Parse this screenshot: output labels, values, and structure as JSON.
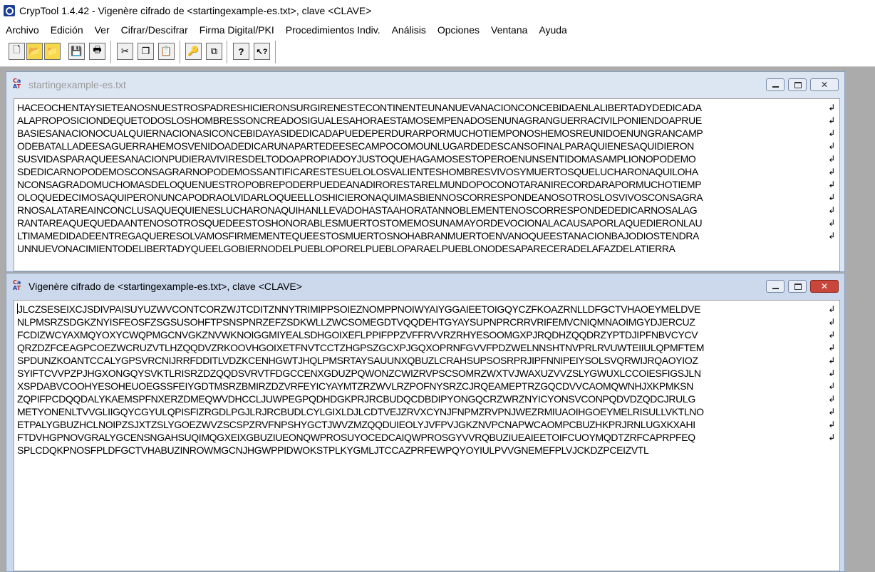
{
  "app": {
    "title": "CrypTool 1.4.42 - Vigenère cifrado de <startingexample-es.txt>, clave <CLAVE>"
  },
  "menu": [
    "Archivo",
    "Edición",
    "Ver",
    "Cifrar/Descifrar",
    "Firma Digital/PKI",
    "Procedimientos Indiv.",
    "Análisis",
    "Opciones",
    "Ventana",
    "Ayuda"
  ],
  "toolbar": {
    "buttons": [
      {
        "name": "new-document-icon",
        "glyph": "🗋"
      },
      {
        "name": "open-folder-icon",
        "glyph": "📂"
      },
      {
        "name": "open-recent-icon",
        "glyph": "📁"
      },
      {
        "name": "save-disk-icon",
        "glyph": "💾"
      },
      {
        "name": "print-icon",
        "glyph": "🖶"
      },
      {
        "name": "cut-scissors-icon",
        "glyph": "✂"
      },
      {
        "name": "copy-icon",
        "glyph": "❐"
      },
      {
        "name": "paste-icon",
        "glyph": "📋"
      },
      {
        "name": "key-icon",
        "glyph": "🔑"
      },
      {
        "name": "window-switch-icon",
        "glyph": "⧉"
      },
      {
        "name": "help-icon",
        "glyph": "?"
      },
      {
        "name": "context-help-icon",
        "glyph": "↖?"
      }
    ]
  },
  "windows": {
    "plaintext": {
      "title": "startingexample-es.txt",
      "lines": [
        "HACEOCHENTAYSIETEANOSNUESTROSPADRESHICIERONSURGIRENESTECONTINENTEUNANUEVANACIONCONCEBIDAENLALIBERTADYDEDICADA",
        "ALAPROPOSICIONDEQUETODOSLOSHOMBRESSONCREADOSIGUALESAHORAESTAMOSEMPENADOSENUNAGRANGUERRACIVILPONIENDOAPRUE",
        "BASIESANACIONOCUALQUIERNACIONASICONCEBIDAYASIDEDICADAPUEDEPERDURARPORMUCHOTIEMPONOSHEMOSREUNIDOENUNGRANCAMP",
        "ODEBATALLADEESAGUERRAHEMOSVENIDOADEDICARUNAPARTEDEESECAMPOCOMOUNLUGARDEDESCANSOFINALPARAQUIENESAQUIDIERON",
        "SUSVIDASPARAQUEESANACIONPUDIERAVIVIRESDELTODOAPROPIADOYJUSTOQUEHAGAMOSESTOPEROENUNSENTIDOMASAMPLIONOPODEMO",
        "SDEDICARNOPODEMOSCONSAGRARNOPODEMOSSANTIFICARESTESUELOLOSVALIENTESHOMBRESVIVOSYMUERTOSQUELUCHARONAQUILOHA",
        "NCONSAGRADOMUCHOMASDELOQUENUESTROPOBREPODERPUEDEANADIRORESTARELMUNDOPOCONOTARANIRECORDARAPORMUCHOTIEMP",
        "OLOQUEDECIMOSAQUIPERONUNCAPODRAOLVIDARLOQUEELLOSHICIERONAQUIMASBIENNOSCORRESPONDEANOSOTROSLOSVIVOSCONSAGRA",
        "RNOSALATAREAINCONCLUSAQUEQUIENESLUCHARONAQUIHANLLEVADOHASTAAHORATANNOBLEMENTENOSCORRESPONDEDEDICARNOSALAG",
        "RANTAREAQUEQUEDAANTENOSOTROSQUEDEESTOSHONORABLESMUERTOSTOMEMOSUNAMAYORDEVOCIONALACAUSAPORLAQUEDIERONLAU",
        "LTIMAMEDIDADEENTREGAQUERESOLVAMOSFIRMEMENTEQUEESTOSMUERTOSNOHABRANMUERTOENVANOQUEESTANACIONBAJODIOSTENDRA",
        "UNNUEVONACIMIENTODELIBERTADYQUEELGOBIERNODELPUEBLOPORELPUEBLOPARAELPUEBLONODESAPARECERADELAFAZDELATIERRA"
      ]
    },
    "ciphertext": {
      "title": "Vigenère cifrado de <startingexample-es.txt>, clave <CLAVE>",
      "lines": [
        "JLCZSESEIXCJSDIVPAISUYUZWVCONTCORZWJTCDITZNNYTRIMIPPSOIEZNOMPPNOIWYAIYGGAIEETOIGQYCZFKOAZRNLLDFGCTVHAOEYMELDVE",
        "NLPMSRZSDGKZNYISFEOSFZSGSUSOHFTPSNSPNRZEFZSDKWLLZWCSOMEGDTVQQDEHTGYAYSUPNPRCRRVRIFEMVCNIQMNAOIMGYDJERCUZ",
        "FCDIZWCYAXMQYOXYCWQPMGCNVGKZNVWKNOIGGMIYEALSDHGOIXEFLPPIFPPZVFFRVVRZRHYESOOMGXPJRQDHZQQDRZYPTDJIPFNBVCYCV",
        "QRZDZFCEAGPCOEZWCRUZVTLHZQQDVZRKOOVHGOIXETFNVTCCTZHGPSZGCXPJGQXOPRNFGVVFPDZWELNNSHTNVPRLRVUWTEIIULQPMFTEM",
        "SPDUNZKOANTCCALYGPSVRCNIJRRFDDITLVDZKCENHGWTJHQLPMSRTAYSAUUNXQBUZLCRAHSUPSOSRPRJIPFNNIPEIYSOLSVQRWIJRQAOYIOZ",
        "SYIFTCVVPZPJHGXONGQYSVKTLRISRZDZQQDSVRVTFDGCCENXGDUZPQWONZCWIZRVPSCSOMRZWXTVJWAXUZVVZSLYGWUXLCCOIESFIGSJLN",
        "XSPDABVCOOHYESOHEUOEGSSFEIYGDTMSRZBMIRZDZVRFEYICYAYMTZRZWVLRZPOFNYSRZCJRQEAMEPTRZGQCDVVCAOMQWNHJXKPMKSN",
        "ZQPIFPCDQQDALYKAEMSPFNXERZDMEQWVDHCCLJUWPEGPQDHDGKPRJRCBUDQCDBDIPYONGQCRZWRZNYICYONSVCONPQDVDZQDCJRULG",
        "METYONENLTVVGLIIGQYCGYULQPISFIZRGDLPGJLRJRCBUDLCYLGIXLDJLCDTVEJZRVXCYNJFNPMZRVPNJWEZRMIUAOIHGOEYMELRISULLVKTLNO",
        "ETPALYGBUZHCLNOIPZSJXTZSLYGOEZWVZSCSPZRVFNPSHYGCTJWVZMZQQDUIEOLYJVFPVJGKZNVPCNAPWCAOMPCBUZHKPRJRNLUGXKXAHI",
        "FTDVHGPNOVGRALYGCENSNGAHSUQIMQGXEIXGBUZIUEONQWPROSUYOCEDCAIQWPROSGYVVRQBUZIUEAIEETOIFCUOYMQDTZRFCAPRPFEQ",
        "SPLCDQKPNOSFPLDFGCTVHABUZINROWMGCNJHGWPPIDWOKSTPLKYGMLJTCCAZPRFEWPQYOYIULPVVGNEMEFPLVJCKDZPCEIZVTL"
      ]
    }
  }
}
